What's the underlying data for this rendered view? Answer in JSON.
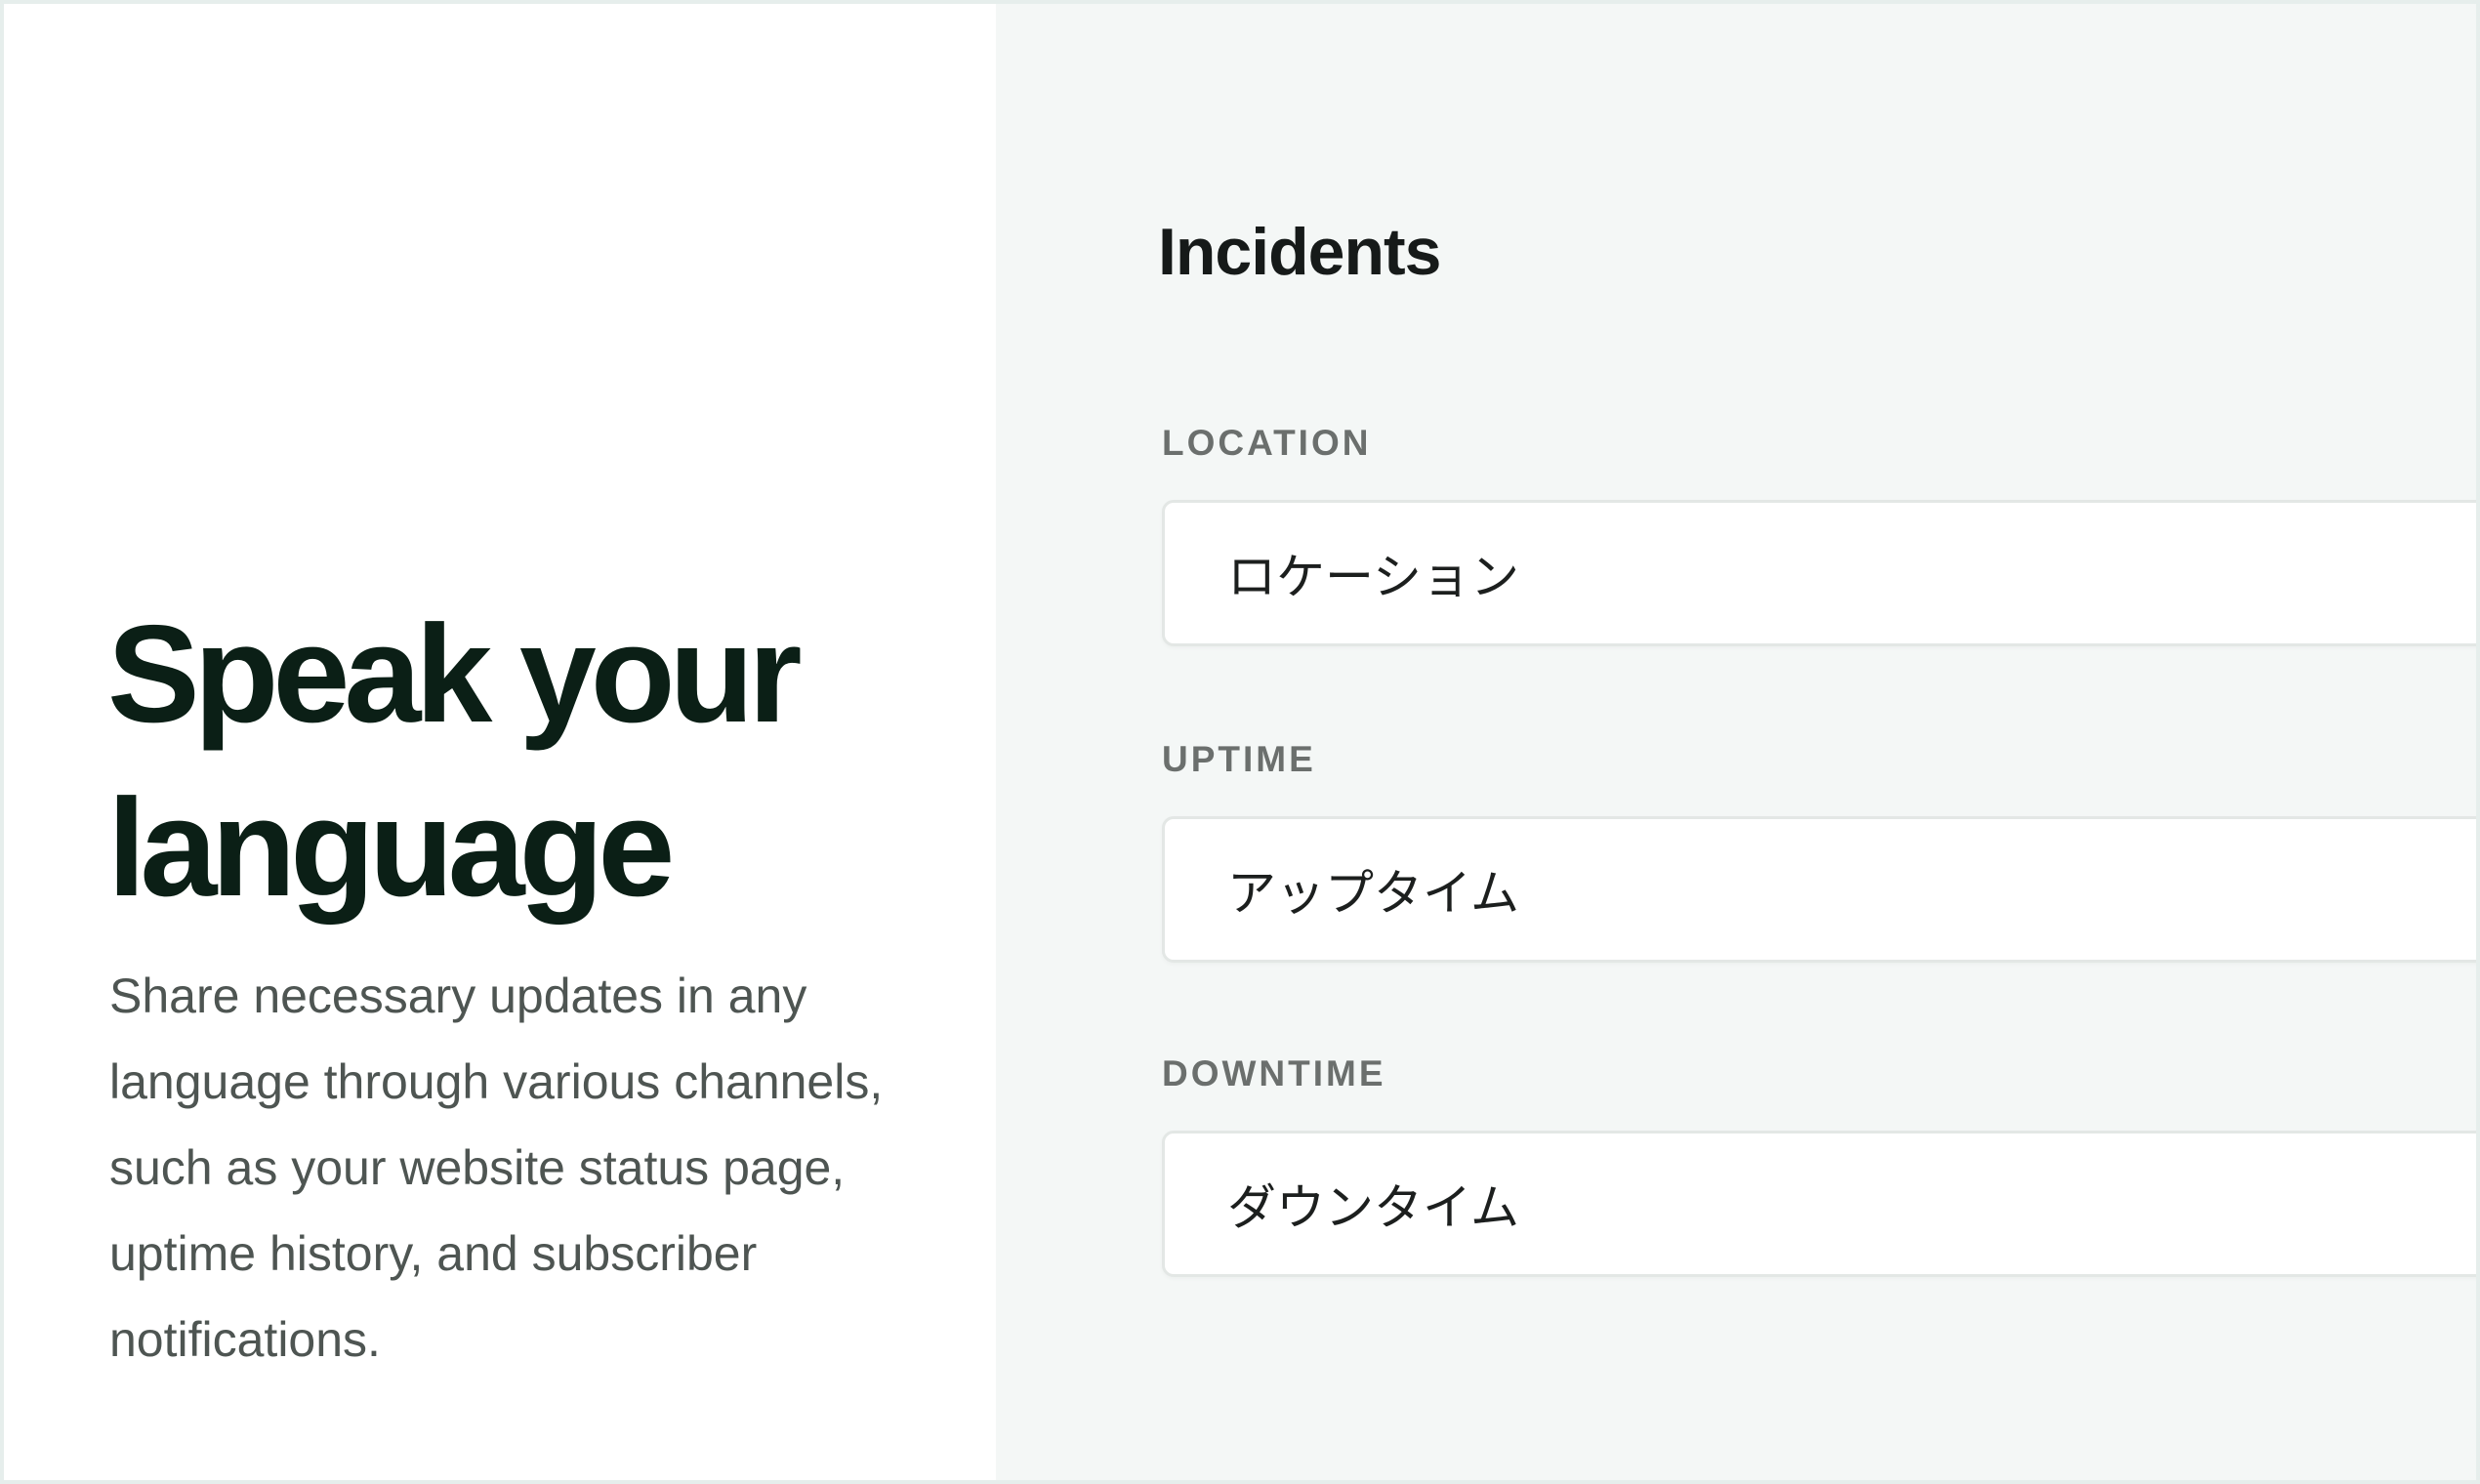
{
  "left_panel": {
    "headline_line1": "Speak your",
    "headline_line2": "language",
    "description": "Share necessary updates in any language through various channels, such as your website status page, uptime history, and subscriber notifications."
  },
  "right_panel": {
    "title": "Incidents",
    "fields": [
      {
        "label": "LOCATION",
        "value": "ロケーション"
      },
      {
        "label": "UPTIME",
        "value": "アップタイム"
      },
      {
        "label": "DOWNTIME",
        "value": "ダウンタイム"
      }
    ]
  },
  "colors": {
    "left_background": "#ffffff",
    "right_background": "#f4f7f6",
    "headline": "#0b1f16",
    "body_text": "#4e5552",
    "label_text": "#6b6f6d",
    "input_border": "#e3e7e5"
  }
}
